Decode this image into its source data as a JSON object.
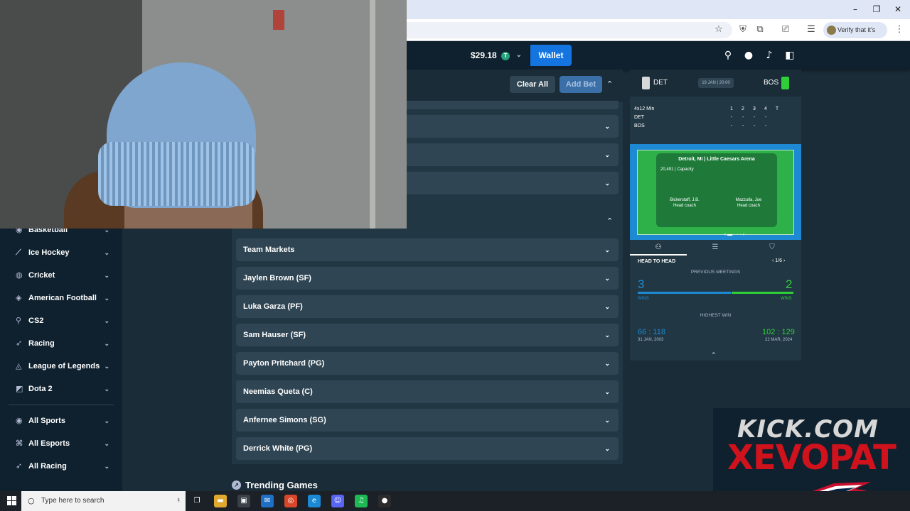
{
  "browser": {
    "profile_label": "Verify that it's you",
    "window_controls": [
      "minimize-icon",
      "restore-icon",
      "close-icon"
    ],
    "toolbar_icons": [
      "star-icon",
      "shield-extension-icon",
      "extensions-icon",
      "screen-capture-icon",
      "reading-list-icon",
      "menu-dots-icon"
    ]
  },
  "header": {
    "balance": "$29.18",
    "currency_icon": "T",
    "wallet_label": "Wallet",
    "icons": [
      "search-icon",
      "user-icon",
      "notifications-icon",
      "betslip-icon"
    ]
  },
  "sidebar": {
    "items": [
      {
        "label": "Basketball",
        "icon": "basketball-icon",
        "glyph": "◉"
      },
      {
        "label": "Ice Hockey",
        "icon": "hockey-stick-icon",
        "glyph": "⟋"
      },
      {
        "label": "Cricket",
        "icon": "cricket-icon",
        "glyph": "◍"
      },
      {
        "label": "American Football",
        "icon": "football-icon",
        "glyph": "◈"
      },
      {
        "label": "CS2",
        "icon": "cs2-icon",
        "glyph": "⚲"
      },
      {
        "label": "Racing",
        "icon": "racing-icon",
        "glyph": "➶"
      },
      {
        "label": "League of Legends",
        "icon": "league-of-legends-icon",
        "glyph": "◬"
      },
      {
        "label": "Dota 2",
        "icon": "dota2-icon",
        "glyph": "◩"
      }
    ],
    "bottom_items": [
      {
        "label": "All Sports",
        "icon": "all-sports-icon",
        "glyph": "◉"
      },
      {
        "label": "All Esports",
        "icon": "all-esports-icon",
        "glyph": "⌘"
      },
      {
        "label": "All Racing",
        "icon": "all-racing-icon",
        "glyph": "➶"
      }
    ]
  },
  "markets": {
    "clear_all": "Clear All",
    "add_bet": "Add Bet",
    "rows": [
      "Team Markets",
      "Jaylen Brown (SF)",
      "Luka Garza (PF)",
      "Sam Hauser (SF)",
      "Payton Pritchard (PG)",
      "Neemias Queta (C)",
      "Anfernee Simons (SG)",
      "Derrick White (PG)"
    ],
    "trending_title": "Trending Games"
  },
  "match": {
    "home": "DET",
    "away": "BOS",
    "date": "19 JAN | 20:00",
    "format": "4x12 Min",
    "quarters": [
      "1",
      "2",
      "3",
      "4",
      "T"
    ],
    "home_scores": [
      "-",
      "-",
      "-",
      "-",
      "-"
    ],
    "away_scores": [
      "-",
      "-",
      "-",
      "-",
      "-"
    ],
    "home_color": "#d7d9db",
    "away_color": "#2fcf3a",
    "venue": "Detroit, MI | Little Caesars Arena",
    "capacity_value": "20,491",
    "capacity_label": "Capacity",
    "home_coach": "Bickerstaff, J.B.",
    "away_coach": "Mazzulla, Joe",
    "coach_role": "Head coach",
    "tabs": [
      "head-to-head-tab-icon",
      "stats-tab-icon",
      "lineup-tab-icon"
    ],
    "h2h_title": "HEAD TO HEAD",
    "h2h_page": "1/6",
    "previous_meetings": "PREVIOUS MEETINGS",
    "home_wins": "3",
    "away_wins": "2",
    "wins_label": "WINS",
    "highest_win_label": "HIGHEST WIN",
    "home_highest": "66 : 118",
    "home_highest_date": "31 JAN, 2003",
    "away_highest": "102 : 129",
    "away_highest_date": "22 MAR, 2024",
    "home_win_fraction": 0.6
  },
  "overlay": {
    "line1": "KICK.COM",
    "line2": "XEVOPAT"
  },
  "taskbar": {
    "search_placeholder": "Type here to search",
    "apps": [
      {
        "name": "task-view-icon",
        "glyph": "❐",
        "color": "#1c2127"
      },
      {
        "name": "file-explorer-icon",
        "glyph": "▬",
        "color": "#e0a82e"
      },
      {
        "name": "store-icon",
        "glyph": "▣",
        "color": "#3a3f48"
      },
      {
        "name": "mail-icon",
        "glyph": "✉",
        "color": "#1f6fc5"
      },
      {
        "name": "chrome-icon",
        "glyph": "◎",
        "color": "#d9472b"
      },
      {
        "name": "edge-icon",
        "glyph": "e",
        "color": "#1a8ad4"
      },
      {
        "name": "discord-icon",
        "glyph": "☺",
        "color": "#5865f2"
      },
      {
        "name": "spotify-icon",
        "glyph": "♫",
        "color": "#1db954"
      },
      {
        "name": "obs-icon",
        "glyph": "●",
        "color": "#2b2b2b"
      }
    ]
  }
}
